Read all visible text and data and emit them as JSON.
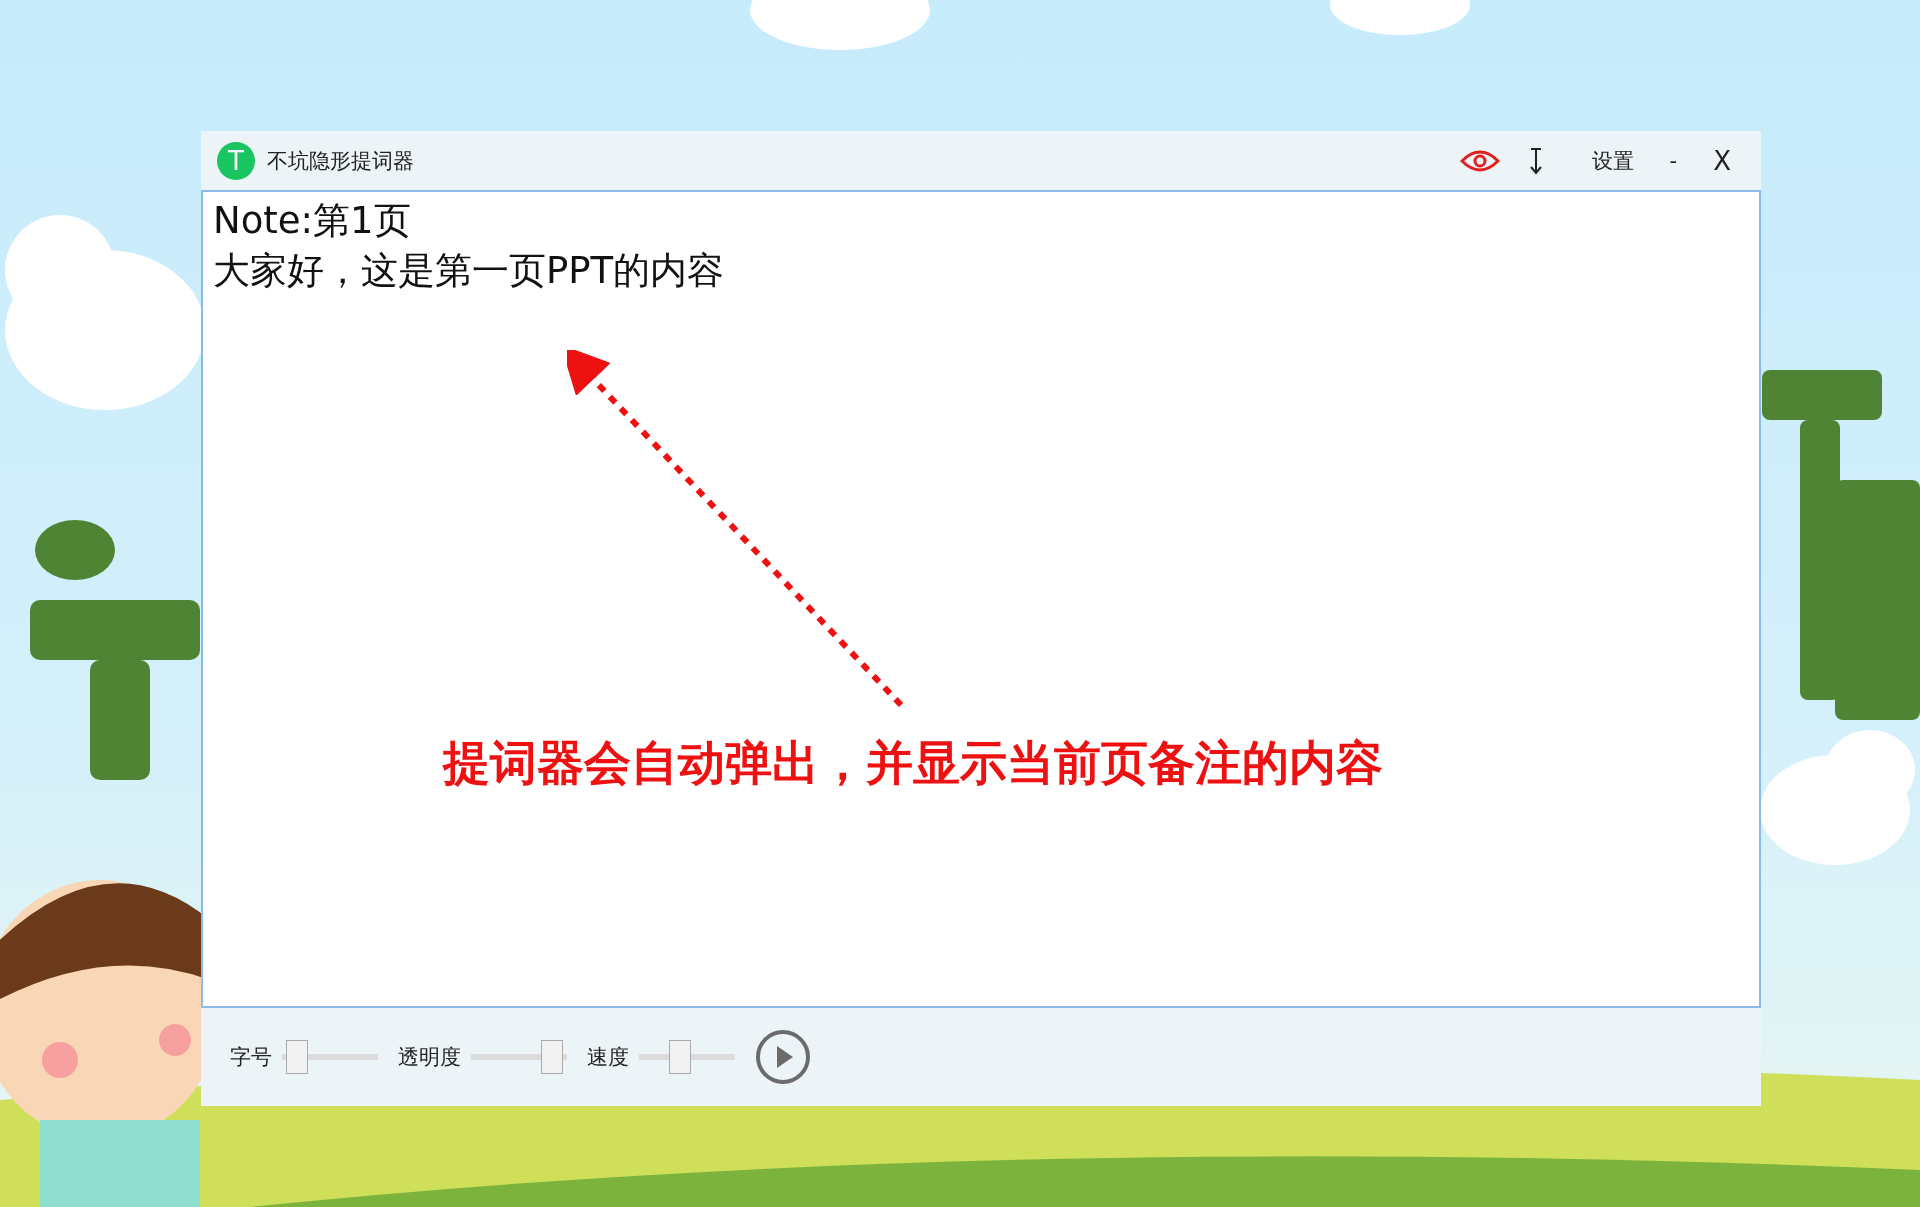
{
  "window": {
    "icon_letter": "T",
    "title": "不坑隐形提词器",
    "settings": "设置",
    "minimize": "-",
    "close": "X"
  },
  "note": {
    "lines": [
      "Note:第1页",
      "大家好，这是第一页PPT的内容"
    ]
  },
  "annotation": {
    "text": "提词器会自动弹出，并显示当前页备注的内容"
  },
  "sliders": [
    {
      "label": "字号",
      "level": 0.05
    },
    {
      "label": "透明度",
      "level": 0.95
    },
    {
      "label": "速度",
      "level": 0.4
    }
  ]
}
